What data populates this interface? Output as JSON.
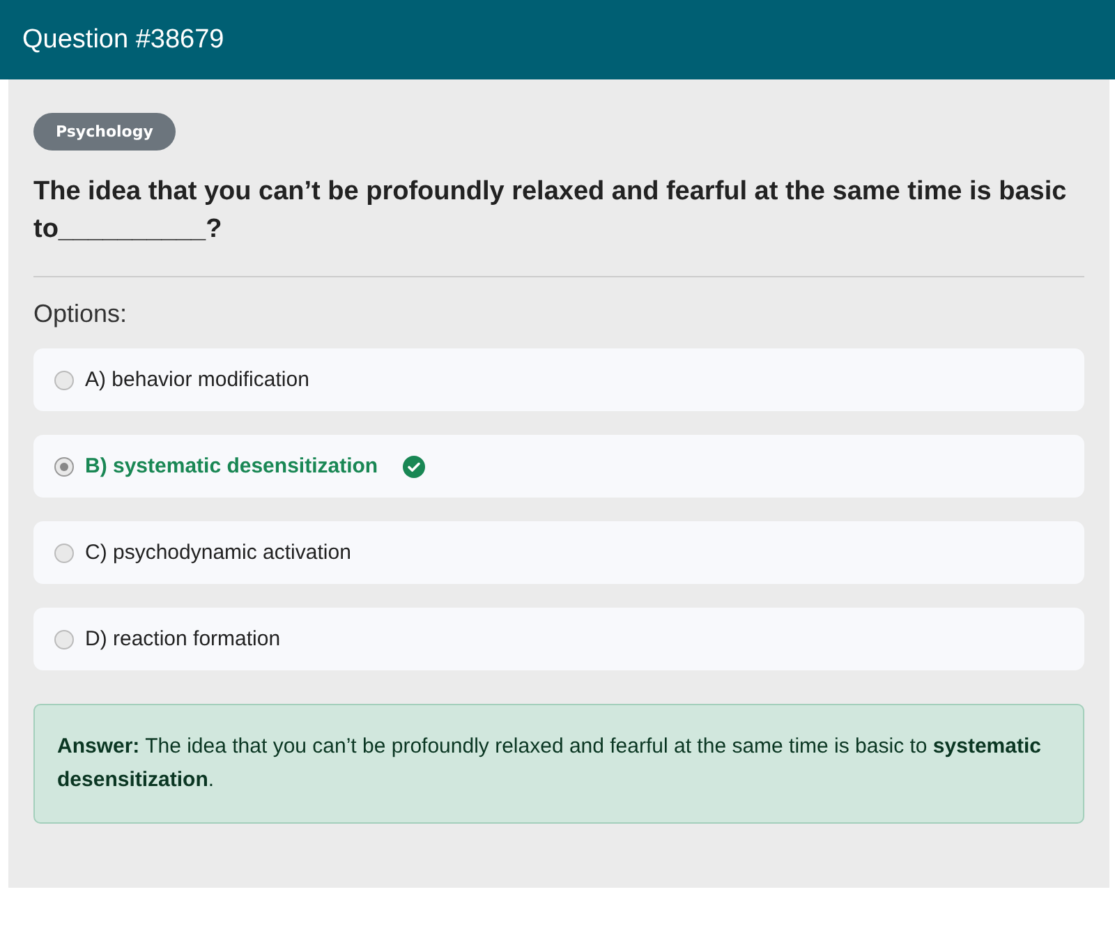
{
  "header": {
    "title": "Question #38679"
  },
  "category": "Psychology",
  "question": "The idea that you can’t be profoundly relaxed and fearful at the same time is basic to__________?",
  "options_label": "Options:",
  "options": [
    {
      "text": "A) behavior modification",
      "selected": false,
      "correct": false
    },
    {
      "text": "B) systematic desensitization",
      "selected": true,
      "correct": true
    },
    {
      "text": "C) psychodynamic activation",
      "selected": false,
      "correct": false
    },
    {
      "text": "D) reaction formation",
      "selected": false,
      "correct": false
    }
  ],
  "answer": "**Answer:** The idea that you can’t be profoundly relaxed and fearful at the same time is basic to **systematic desensitization**."
}
